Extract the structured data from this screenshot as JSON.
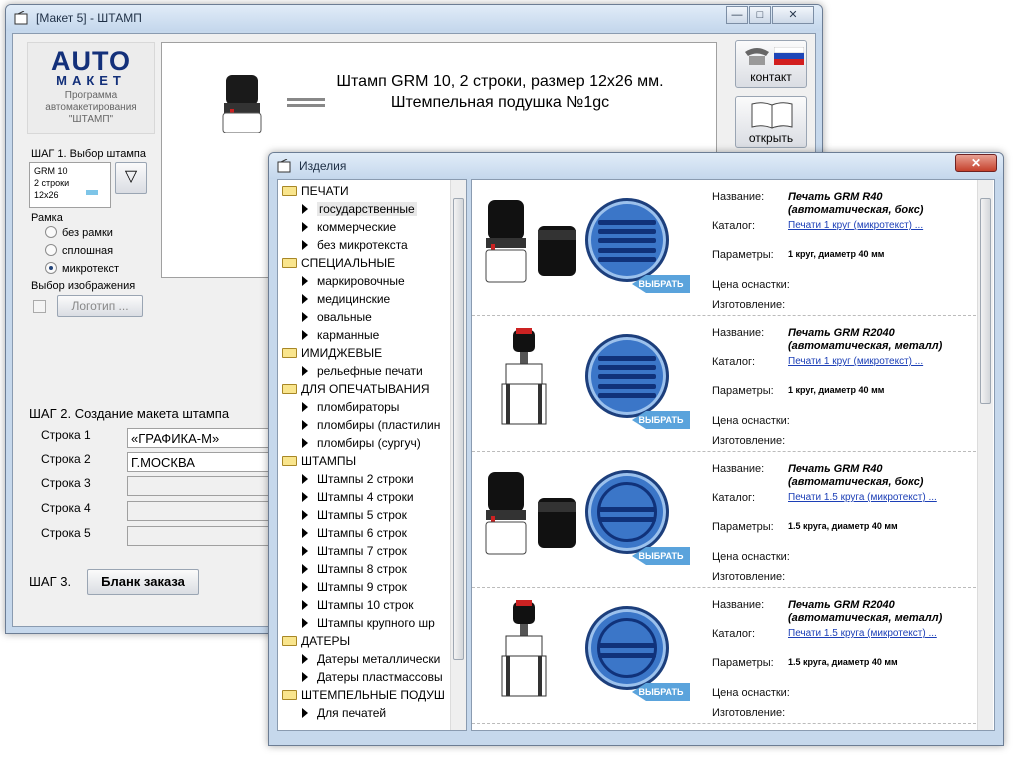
{
  "main_window": {
    "title": "[Макет 5] - ШТАМП",
    "controls": [
      "—",
      "□",
      "✕"
    ],
    "logo": {
      "word1": "AUTO",
      "word2": "МАКЕТ",
      "caption": "Программа автомакетирования \"ШТАМП\""
    },
    "preview": {
      "text": "Штамп GRM 10, 2 строки, размер 12x26 мм. Штемпельная подушка №1gc"
    },
    "contact_label": "контакт",
    "open_label": "открыть",
    "step1": {
      "label": "ШАГ 1. Выбор штампа",
      "model_line1": "GRM 10",
      "model_line2": "2 строки",
      "size": "12x26",
      "dropdown_icon": "▽"
    },
    "frame": {
      "label": "Рамка",
      "options": [
        "без рамки",
        "сплошная",
        "микротекст"
      ]
    },
    "image": {
      "label": "Выбор изображения",
      "logo_button": "Логотип ..."
    },
    "step2": {
      "label": "ШАГ 2. Создание макета штампа",
      "rows": [
        {
          "label": "Строка 1",
          "value": "«ГРАФИКА-М»"
        },
        {
          "label": "Строка 2",
          "value": "Г.МОСКВА"
        },
        {
          "label": "Строка 3",
          "value": ""
        },
        {
          "label": "Строка 4",
          "value": ""
        },
        {
          "label": "Строка 5",
          "value": ""
        }
      ]
    },
    "step3": {
      "label": "ШАГ 3.",
      "order_button": "Бланк заказа"
    }
  },
  "catalog_window": {
    "title": "Изделия",
    "close": "✕",
    "tree": [
      {
        "kind": "folder",
        "label": "ПЕЧАТИ"
      },
      {
        "kind": "leaf",
        "label": "государственные",
        "selected": true
      },
      {
        "kind": "leaf",
        "label": "коммерческие"
      },
      {
        "kind": "leaf",
        "label": "без микротекста"
      },
      {
        "kind": "folder",
        "label": "СПЕЦИАЛЬНЫЕ"
      },
      {
        "kind": "leaf",
        "label": "маркировочные"
      },
      {
        "kind": "leaf",
        "label": "медицинские"
      },
      {
        "kind": "leaf",
        "label": "овальные"
      },
      {
        "kind": "leaf",
        "label": "карманные"
      },
      {
        "kind": "folder",
        "label": "ИМИДЖЕВЫЕ"
      },
      {
        "kind": "leaf",
        "label": "рельефные печати"
      },
      {
        "kind": "folder",
        "label": "ДЛЯ ОПЕЧАТЫВАНИЯ"
      },
      {
        "kind": "leaf",
        "label": "пломбираторы"
      },
      {
        "kind": "leaf",
        "label": "пломбиры (пластилин"
      },
      {
        "kind": "leaf",
        "label": "пломбиры (сургуч)"
      },
      {
        "kind": "folder",
        "label": "ШТАМПЫ"
      },
      {
        "kind": "leaf",
        "label": "Штампы 2 строки"
      },
      {
        "kind": "leaf",
        "label": "Штампы 4 строки"
      },
      {
        "kind": "leaf",
        "label": "Штампы 5 строк"
      },
      {
        "kind": "leaf",
        "label": "Штампы 6 строк"
      },
      {
        "kind": "leaf",
        "label": "Штампы 7 строк"
      },
      {
        "kind": "leaf",
        "label": "Штампы 8 строк"
      },
      {
        "kind": "leaf",
        "label": "Штампы 9 строк"
      },
      {
        "kind": "leaf",
        "label": "Штампы 10 строк"
      },
      {
        "kind": "leaf",
        "label": "Штампы крупного шр"
      },
      {
        "kind": "folder",
        "label": "ДАТЕРЫ"
      },
      {
        "kind": "leaf",
        "label": "Датеры металлически"
      },
      {
        "kind": "leaf",
        "label": "Датеры пластмассовы"
      },
      {
        "kind": "folder",
        "label": "ШТЕМПЕЛЬНЫЕ ПОДУШ"
      },
      {
        "kind": "leaf",
        "label": "Для печатей"
      }
    ],
    "field_labels": {
      "name": "Название:",
      "catalog": "Каталог:",
      "params": "Параметры:",
      "price": "Цена оснастки:",
      "made": "Изготовление:"
    },
    "pick_label": "ВЫБРАТЬ",
    "items": [
      {
        "name1": "Печать GRM R40",
        "name2": "(автоматическая, бокс)",
        "catalog": "Печати 1 круг (микротекст) ...",
        "params": "1 круг, диаметр 40 мм",
        "device": "box",
        "seal": "lines"
      },
      {
        "name1": "Печать GRM R2040",
        "name2": "(автоматическая, металл)",
        "catalog": "Печати 1 круг (микротекст) ...",
        "params": "1 круг, диаметр 40 мм",
        "device": "metal",
        "seal": "lines"
      },
      {
        "name1": "Печать GRM R40",
        "name2": "(автоматическая, бокс)",
        "catalog": "Печати 1.5 круга (микротекст) ...",
        "params": "1.5 круга, диаметр 40 мм",
        "device": "box",
        "seal": "ring"
      },
      {
        "name1": "Печать GRM R2040",
        "name2": "(автоматическая, металл)",
        "catalog": "Печати 1.5 круга (микротекст) ...",
        "params": "1.5 круга, диаметр 40 мм",
        "device": "metal",
        "seal": "ring"
      }
    ]
  },
  "colors": {
    "title_bar": "#c4d7ec",
    "seal_blue": "#3b76c8",
    "pick_blue": "#5aa3dc",
    "link": "#1c3fb6"
  }
}
